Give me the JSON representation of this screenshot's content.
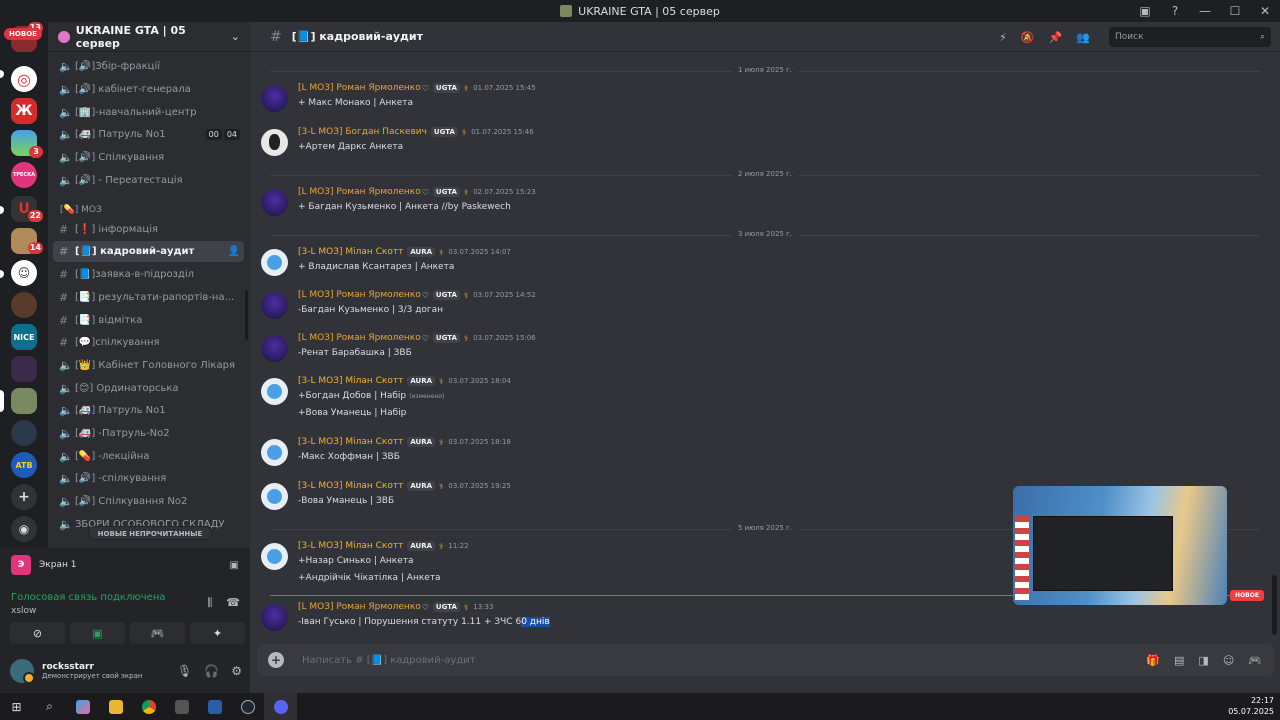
{
  "window": {
    "title": "UKRAINE GTA | 05 сервер"
  },
  "servers": {
    "new_label": "НОВОЕ",
    "badges": [
      "13",
      "3",
      "22",
      "14"
    ],
    "nice_label": "NICE",
    "atb_label": "ATB",
    "treska_label": "ТРЕСКА"
  },
  "guild": {
    "name": "UKRAINE GTA | 05 сервер"
  },
  "channels": {
    "items": [
      "[🔊]Збір-фракції",
      "[🔊] кабінет-генерала",
      "[🏢]-навчальний-центр",
      "[🚑] Патруль No1",
      "[🔊] Спілкування",
      "[🔊] - Переатестація",
      "[❗] інформація",
      "[📘] кадровий-аудит",
      "[📘]заявка-в-підрозділ",
      "[📑] результати-рапортів-на...",
      "[📑] відмітка",
      "[💬]спілкування",
      "[👑] Кабінет Головного Лікаря",
      "[😊] Ординаторська",
      "[🚑] Патруль No1",
      "[🚑] -Патруль-No2",
      "[💊] -лекційна",
      "[🔊] -спілкування",
      "[🔊] Спілкування No2",
      "ЗБОРИ ОСОБОВОГО СКЛАДУ"
    ],
    "patrol_counts": [
      "00",
      "04"
    ],
    "category": "[💊] МОЗ",
    "unread_pill": "НОВЫЕ НЕПРОЧИТАННЫЕ"
  },
  "userpanel": {
    "stream_label": "Экран 1",
    "voice_status": "Голосовая связь подключена",
    "voice_channel": "xslow",
    "username": "rocksstarr",
    "user_status": "Демонстрирует свой экран"
  },
  "header": {
    "channel_name": "[📘] кадровий-аудит",
    "search_placeholder": "Поиск"
  },
  "dates": [
    "1 июля 2025 г.",
    "2 июля 2025 г.",
    "3 июля 2025 г.",
    "5 июля 2025 г."
  ],
  "messages": [
    {
      "author": "[L МОЗ] Роман Ярмоленко",
      "tag": "UGTA",
      "time": "01.07.2025 15:45",
      "lines": [
        "+ Макс Монако | Анкета"
      ]
    },
    {
      "author": "[3-L МОЗ] Богдан Паскевич",
      "tag": "UGTA",
      "time": "01.07.2025 15:46",
      "lines": [
        "+Артем Даркс Анкета"
      ]
    },
    {
      "author": "[L МОЗ] Роман Ярмоленко",
      "tag": "UGTA",
      "time": "02.07.2025 15:23",
      "lines": [
        "+ Багдан Кузьменко  |  Анкета //by Paskewech"
      ]
    },
    {
      "author": "[3-L МОЗ] Мілан Скотт",
      "tag": "AURA",
      "time": "03.07.2025 14:07",
      "lines": [
        "+ Владислав Ксантарез | Анкета"
      ]
    },
    {
      "author": "[L МОЗ] Роман Ярмоленко",
      "tag": "UGTA",
      "time": "03.07.2025 14:52",
      "lines": [
        "-Багдан Кузьменко  |  3/3 доган"
      ]
    },
    {
      "author": "[L МОЗ] Роман Ярмоленко",
      "tag": "UGTA",
      "time": "03.07.2025 15:06",
      "lines": [
        "-Ренат Барабашка |  ЗВБ"
      ]
    },
    {
      "author": "[3-L МОЗ] Мілан Скотт",
      "tag": "AURA",
      "time": "03.07.2025 18:04",
      "lines": [
        "+Богдан Добов | Набір",
        "+Вова Уманець | Набір"
      ],
      "edited": "(изменено)"
    },
    {
      "author": "[3-L МОЗ] Мілан Скотт",
      "tag": "AURA",
      "time": "03.07.2025 18:18",
      "lines": [
        "-Макс Хоффман | ЗВБ"
      ]
    },
    {
      "author": "[3-L МОЗ] Мілан Скотт",
      "tag": "AURA",
      "time": "03.07.2025 19:25",
      "lines": [
        "-Вова Уманець | ЗВБ"
      ]
    },
    {
      "author": "[3-L МОЗ] Мілан Скотт",
      "tag": "AURA",
      "time": "11:22",
      "lines": [
        "+Назар Синько | Анкета",
        "+Андрійчік Чікатілка | Анкета"
      ]
    },
    {
      "author": "[L МОЗ] Роман Ярмоленко",
      "tag": "UGTA",
      "time": "13:33",
      "lines": [
        "-Іван Гусько | Порушення статуту 1.11 + ЗЧС 6"
      ],
      "highlight": "0 днів"
    }
  ],
  "new_marker": "НОВОЕ",
  "composer": {
    "placeholder": "Написать # [📘] кадровий-аудит"
  },
  "taskbar": {
    "time": "22:17",
    "date": "05.07.2025"
  }
}
